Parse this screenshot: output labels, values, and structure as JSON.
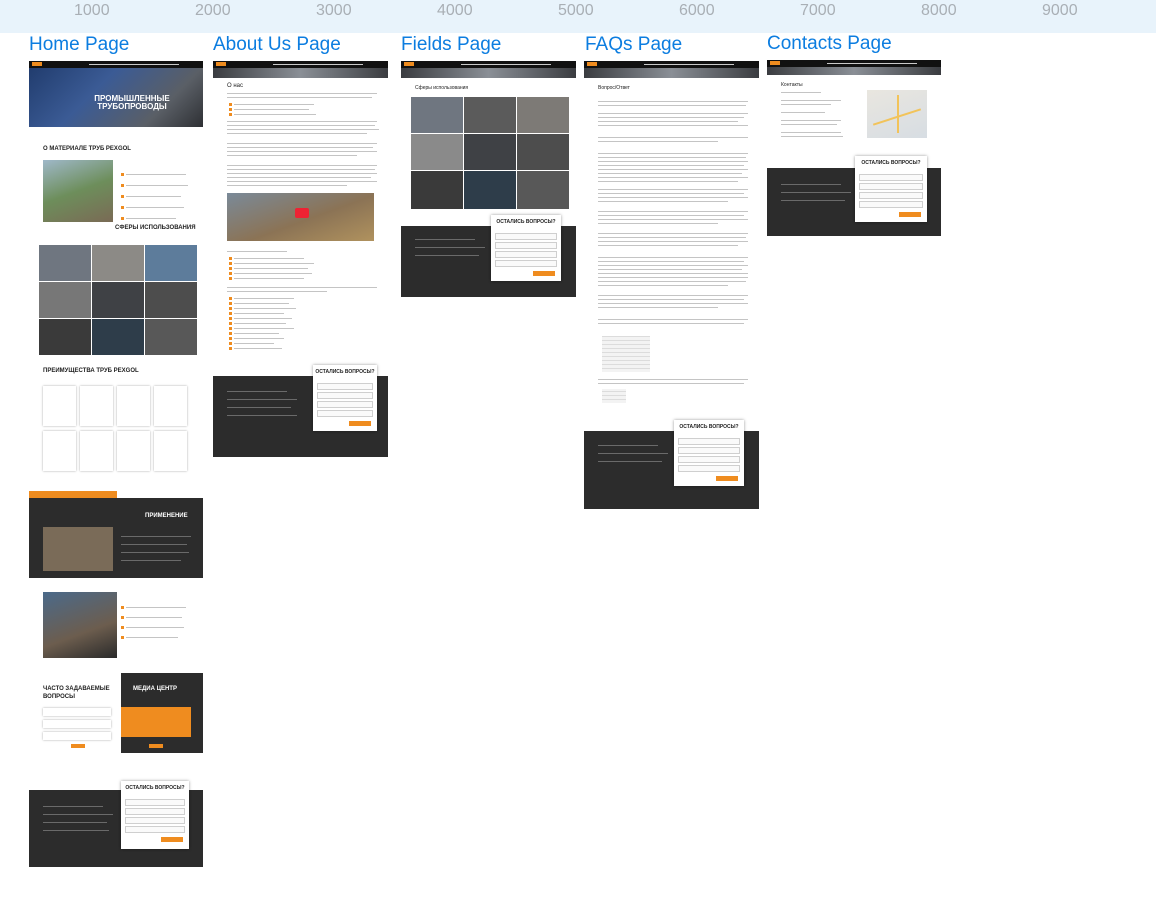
{
  "ruler": {
    "ticks": [
      "1000",
      "2000",
      "3000",
      "4000",
      "5000",
      "6000",
      "7000",
      "8000",
      "9000"
    ]
  },
  "frames": [
    {
      "title": "Home Page"
    },
    {
      "title": "About Us Page"
    },
    {
      "title": "Fields Page"
    },
    {
      "title": "FAQs Page"
    },
    {
      "title": "Contacts Page"
    }
  ],
  "home": {
    "hero_title": "ПРОМЫШЛЕННЫЕ ТРУБОПРОВОДЫ",
    "about_pipes": "О МАТЕРИАЛЕ ТРУБ PEXGOL",
    "fields": "СФЕРЫ ИСПОЛЬЗОВАНИЯ",
    "advantages": "ПРЕИМУЩЕСТВА ТРУБ PEXGOL",
    "application": "ПРИМЕНЕНИЕ",
    "faq": "ЧАСТО ЗАДАВАЕМЫЕ ВОПРОСЫ",
    "media": "МЕДИА ЦЕНТР",
    "form_title": "ОСТАЛИСЬ ВОПРОСЫ?"
  },
  "about": {
    "heading": "О нас",
    "form_title": "ОСТАЛИСЬ ВОПРОСЫ?"
  },
  "fields_page": {
    "heading": "Сферы использования",
    "form_title": "ОСТАЛИСЬ ВОПРОСЫ?"
  },
  "faqs": {
    "heading": "Вопрос/Ответ",
    "form_title": "ОСТАЛИСЬ ВОПРОСЫ?"
  },
  "contacts": {
    "heading": "Контакты",
    "form_title": "ОСТАЛИСЬ ВОПРОСЫ?"
  },
  "colors": {
    "accent": "#ef8c1f",
    "dark": "#2c2c2c",
    "title_blue": "#0c7de0"
  }
}
